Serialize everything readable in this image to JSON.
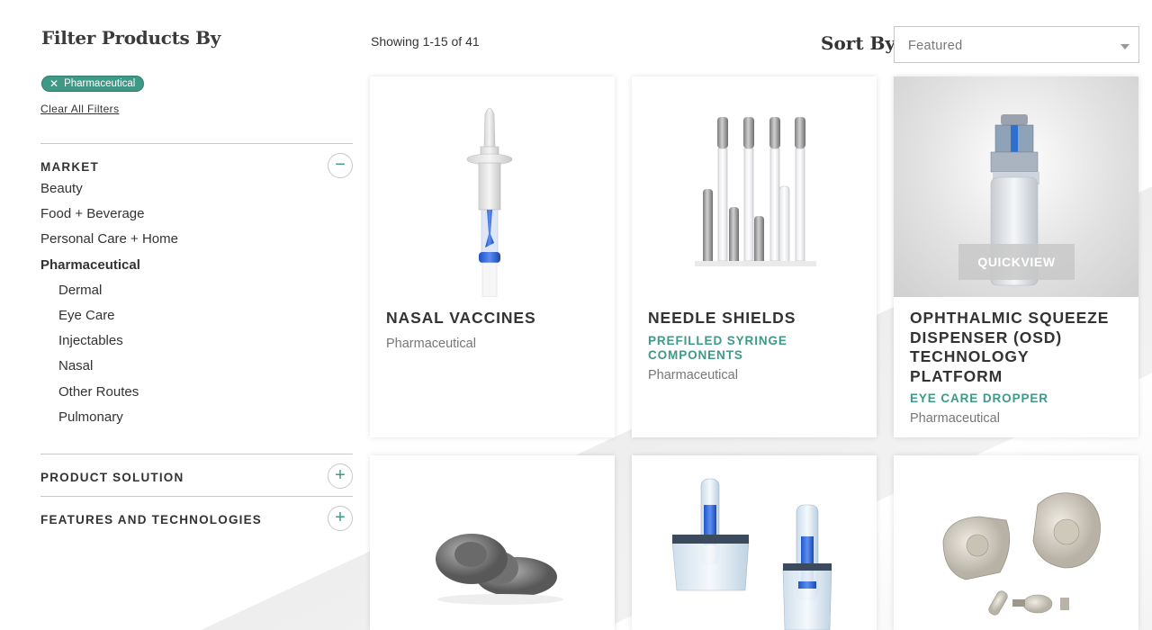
{
  "sidebar": {
    "title": "Filter Products By",
    "active_filter": "Pharmaceutical",
    "clear_all": "Clear All Filters",
    "market": {
      "title": "MARKET",
      "toggle": "−",
      "items": [
        {
          "label": "Beauty"
        },
        {
          "label": "Food + Beverage"
        },
        {
          "label": "Personal Care + Home"
        },
        {
          "label": "Pharmaceutical"
        },
        {
          "label": "Dermal"
        },
        {
          "label": "Eye Care"
        },
        {
          "label": "Injectables"
        },
        {
          "label": "Nasal"
        },
        {
          "label": "Other Routes"
        },
        {
          "label": "Pulmonary"
        }
      ]
    },
    "product_solution": {
      "title": "PRODUCT SOLUTION",
      "toggle": "+"
    },
    "features": {
      "title": "FEATURES AND TECHNOLOGIES",
      "toggle": "+"
    }
  },
  "results": {
    "showing": "Showing 1-15 of 41"
  },
  "sort": {
    "label": "Sort By",
    "selected": "Featured"
  },
  "products": [
    {
      "title": "NASAL VACCINES",
      "subtitle": "",
      "market": "Pharmaceutical"
    },
    {
      "title": "NEEDLE SHIELDS",
      "subtitle": "PREFILLED SYRINGE COMPONENTS",
      "market": "Pharmaceutical"
    },
    {
      "title": "OPHTHALMIC SQUEEZE DISPENSER (OSD) TECHNOLOGY PLATFORM",
      "subtitle": "EYE CARE DROPPER",
      "market": "Pharmaceutical",
      "quickview": "QUICKVIEW"
    }
  ],
  "colors": {
    "accent": "#3f9987",
    "text": "#333333",
    "muted": "#777777"
  },
  "icons": {
    "chip_close": "close-icon",
    "sort_caret": "caret-down-icon"
  }
}
